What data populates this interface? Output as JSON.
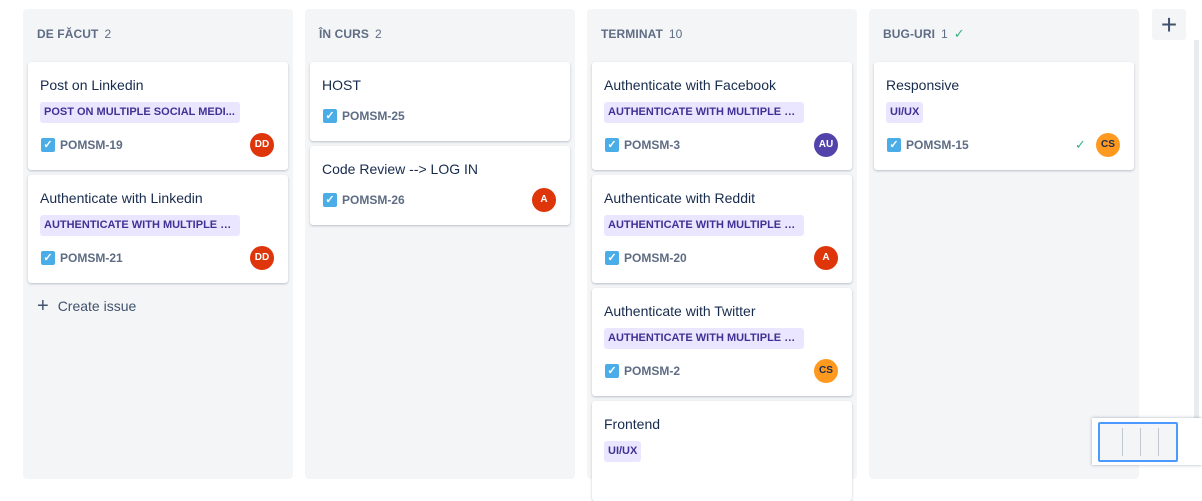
{
  "columns": [
    {
      "title": "DE FĂCUT",
      "count": "2",
      "done_mark": "",
      "cards": [
        {
          "title": "Post on Linkedin",
          "epic": "POST ON MULTIPLE SOCIAL MEDI...",
          "key": "POMSM-19",
          "avatar": "DD",
          "avatar_color": "#de350b"
        },
        {
          "title": "Authenticate with Linkedin",
          "epic": "AUTHENTICATE WITH MULTIPLE S...",
          "key": "POMSM-21",
          "avatar": "DD",
          "avatar_color": "#de350b"
        }
      ],
      "create_label": "Create issue"
    },
    {
      "title": "ÎN CURS",
      "count": "2",
      "done_mark": "",
      "cards": [
        {
          "title": "HOST",
          "epic": "",
          "key": "POMSM-25",
          "avatar": "",
          "avatar_color": ""
        },
        {
          "title": "Code Review --> LOG IN",
          "epic": "",
          "key": "POMSM-26",
          "avatar": "A",
          "avatar_color": "#de350b"
        }
      ]
    },
    {
      "title": "TERMINAT",
      "count": "10",
      "done_mark": "",
      "cards": [
        {
          "title": "Authenticate with Facebook",
          "epic": "AUTHENTICATE WITH MULTIPLE S...",
          "key": "POMSM-3",
          "avatar": "AU",
          "avatar_color": "#5243aa"
        },
        {
          "title": "Authenticate with Reddit",
          "epic": "AUTHENTICATE WITH MULTIPLE S...",
          "key": "POMSM-20",
          "avatar": "A",
          "avatar_color": "#de350b"
        },
        {
          "title": "Authenticate with Twitter",
          "epic": "AUTHENTICATE WITH MULTIPLE S...",
          "key": "POMSM-2",
          "avatar": "CS",
          "avatar_color": "#ff991f"
        },
        {
          "title": "Frontend",
          "epic": "UI/UX",
          "key": "",
          "avatar": "",
          "avatar_color": ""
        }
      ]
    },
    {
      "title": "BUG-URI",
      "count": "1",
      "done_mark": "✓",
      "cards": [
        {
          "title": "Responsive",
          "epic": "UI/UX",
          "key": "POMSM-15",
          "avatar": "CS",
          "avatar_color": "#ff991f",
          "done": "✓"
        }
      ]
    }
  ],
  "add_column_icon": "plus-icon",
  "checkbox_icon": "story-checkbox-icon",
  "check_glyph": "✓",
  "colors": {
    "epic_bg": "#eae6ff",
    "epic_text": "#403294",
    "column_bg": "#f4f5f7",
    "checkbox": "#4bade8"
  }
}
